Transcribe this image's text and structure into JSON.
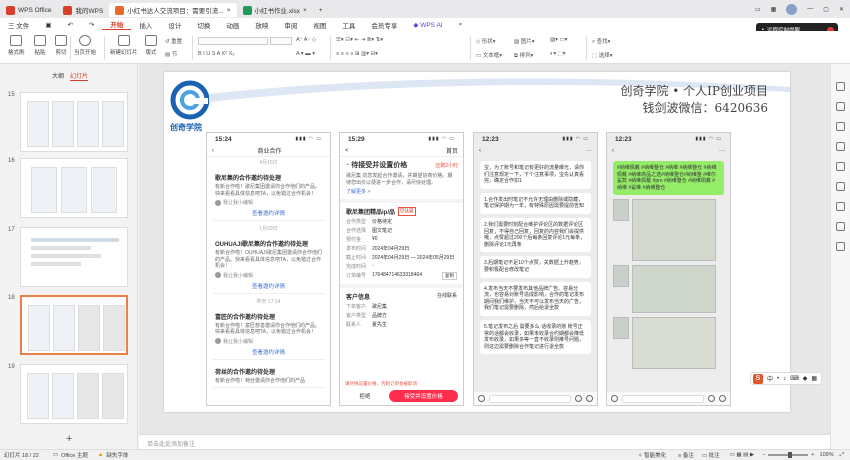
{
  "titlebar": {
    "tabs": [
      {
        "label": "WPS Office",
        "color": "#d9402b"
      },
      {
        "label": "我的WPS",
        "color": "#d9402b"
      },
      {
        "label": "小红书达人交流项目：需要引流...",
        "color": "#e86a2b"
      },
      {
        "label": "小红书作业.xlsx",
        "color": "#1e9b5a"
      }
    ],
    "new_tab": "+"
  },
  "menubar": {
    "file": "三 文件",
    "items": [
      "开始",
      "插入",
      "设计",
      "切换",
      "动画",
      "放映",
      "审阅",
      "视图",
      "工具",
      "会员专享"
    ],
    "active": "开始",
    "wps_ai": "WPS AI"
  },
  "ribbon": {
    "format_painter": "格式刷",
    "paste": "粘贴",
    "cut": "剪切",
    "play": "当页开始",
    "new_slide": "新建幻灯片",
    "layout": "版式",
    "reset": "重置",
    "section": "节",
    "shape": "形状",
    "picture": "图片",
    "textbox": "文本框",
    "arrange": "排列",
    "find": "查找",
    "select": "选择"
  },
  "remote": {
    "label": "远程控制提醒",
    "badge": "2"
  },
  "leftpanel": {
    "tabs": [
      "大纲",
      "幻灯片"
    ],
    "thumbnails": [
      {
        "num": "15"
      },
      {
        "num": "16"
      },
      {
        "num": "17"
      },
      {
        "num": "18"
      },
      {
        "num": "19"
      }
    ],
    "add": "+"
  },
  "slide": {
    "brand_line1": "创奇学院 • 个人IP创业项目",
    "brand_line2": "钱剑波微信：6420636",
    "logo_text": "创奇学院",
    "phone1": {
      "time": "15:24",
      "title": "商业合作",
      "cards": [
        {
          "head": "歌尼集的合作邀约待处理",
          "body": "有新合作啦！歌尼集团邀请你合作他们的产品。快来看看具体信息吧TA，以免错过合作机会！",
          "who": "我让我小编辑",
          "act": "查看邀约详情"
        },
        {
          "head": "OUHUAJI歌尼集的合作邀约待处理",
          "body": "有新合作啦！OUHUAJI歌尼集团邀请你合作他们的产品。快来看看具体信息吧TA，以免错过合作机会！",
          "who": "我让我小编辑",
          "act": "查看邀约详情"
        },
        {
          "head": "富匠的合作邀约待处理",
          "body": "有新合作啦！富匠慈善邀请你合作他们的产品。快来看看具体信息吧TA，以免错过合作机会！",
          "who": "我让我小编辑",
          "act": "查看邀约详情"
        },
        {
          "head": "荷丝的合作邀约待处理",
          "body": "有新合作啦！荷丝邀请你合作他们的产品",
          "who": "",
          "act": ""
        }
      ],
      "stamps": [
        "4月15日",
        "1月29日",
        "昨天 17:14"
      ]
    },
    "phone2": {
      "time": "15:29",
      "back": "<",
      "more": "首页",
      "title": "待接受并设置价格",
      "deadline": "还剩2小时",
      "desc": "歌尼集 向您发起合作邀请，并期望协商价格。期待您出价以便进一步合作，请尽快处理。",
      "more_link": "了解更多 >",
      "brand": "歌尼集团精品ip/品",
      "brand_tag": "已认证",
      "rows": [
        {
          "k": "合作类型",
          "v": "价格待定"
        },
        {
          "k": "合作选择",
          "v": "图文笔记"
        },
        {
          "k": "预付金",
          "v": "¥0"
        },
        {
          "k": "发布时间",
          "v": "2024年04月29日"
        },
        {
          "k": "截止时间",
          "v": "2024年04月29日 — 2024年05月29日"
        },
        {
          "k": "完成时间",
          "v": "-"
        },
        {
          "k": "订单编号",
          "v": "176484714633318464"
        }
      ],
      "copy": "复制",
      "partner_label": "客户信息",
      "partner_link": "在线联系",
      "partner_rows": [
        {
          "k": "下单客户",
          "v": "歌尼集"
        },
        {
          "k": "客户类型",
          "v": "品牌方"
        },
        {
          "k": "联系人",
          "v": "夏先生"
        }
      ],
      "notice": "请尽快设置价格，否则订单会被取消",
      "btn_reject": "拒绝",
      "btn_accept": "接受并设置价格"
    },
    "phone3": {
      "time": "12:23",
      "bubble1": "宝，为了账号和笔记有更好的流量曝光，请你们注意规定一下，下个注意事项，宝先认真看完，确定合作扣1",
      "bubble2": "1.合作发出时笔记不允许无理由删除或隐藏，笔记保护期为一年，有特殊原因需要提前告知",
      "bubble3": "2.我们需要时刻配合维护评论区的数据评论区回复，不得自己回复，回复的内容我们会提供哦，点赞超过200个后每条回复评论1元每条，删除评论1元再条",
      "bubble4": "3.后期笔记不足10个点赞，关数据上升趋势，要积极配合修改笔记",
      "bubble5": "4.发布当天不要发布其他品牌广告、容易分流，也容易对账号造成影响，合作的笔记发布期间我们维护，当天不可以发布当天的广告，我们笔记需要删除，然后给退全款",
      "bubble6": "5.笔记发布之后 需要多么·话收录的账 账号正常的话都会收录，如果未收录合约期都会降低发布收录，如果多等一直不收录则推号问题，则这边需要删除合作笔记进行退全款"
    },
    "phone4": {
      "time": "12:23",
      "tags": "#纳维佩戴 #纳维整仓 #纳维 #纳维整仓 #纳维佩戴 #纳维商品之选#纳维整仓#纳维整 #维尔鲨款 #纳维佩戴 #pro #纳维整仓 #纳维佩戴 #纳维 #鲨维 #纳维整仓"
    }
  },
  "notes_placeholder": "单击此处添加备注",
  "statusbar": {
    "slide": "幻灯片 18 / 22",
    "theme": "Office 主题",
    "font_missing": "缺失字体",
    "smart_beautify": "智能美化",
    "notes": "备注",
    "comments": "批注",
    "zoom": "109%"
  },
  "ime": {
    "label": "中"
  }
}
